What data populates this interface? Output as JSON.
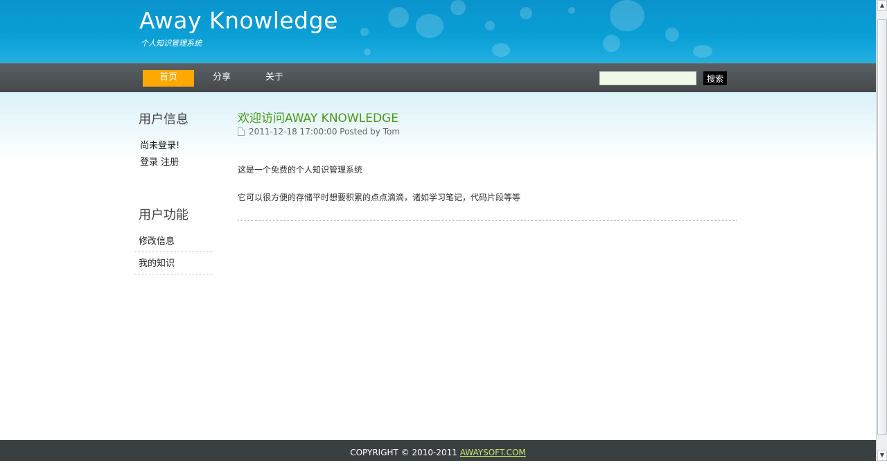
{
  "header": {
    "title": "Away Knowledge",
    "subtitle": "个人知识管理系统"
  },
  "nav": {
    "items": [
      {
        "label": "首页",
        "active": true
      },
      {
        "label": "分享",
        "active": false
      },
      {
        "label": "关于",
        "active": false
      }
    ],
    "search_value": "",
    "search_button": "搜索"
  },
  "sidebar": {
    "user_info_heading": "用户信息",
    "not_logged_in": "尚未登录!",
    "login_link": "登录",
    "register_link": "注册",
    "user_functions_heading": "用户功能",
    "menu": [
      "修改信息",
      "我的知识"
    ]
  },
  "post": {
    "title": "欢迎访问AWAY KNOWLEDGE",
    "meta": "2011-12-18 17:00:00 Posted by Tom",
    "paragraphs": [
      "这是一个免费的个人知识管理系统",
      "它可以很方便的存储平时想要积累的点点滴滴，诸如学习笔记，代码片段等等"
    ]
  },
  "footer": {
    "copyright": "COPYRIGHT © 2010-2011",
    "link": "AWAYSOFT.COM"
  },
  "colors": {
    "header": "#0aa0d6",
    "nav": "#4a4e51",
    "active_tab": "#ffa800",
    "post_title": "#4a9a1a",
    "footer_link": "#c8e86a"
  }
}
